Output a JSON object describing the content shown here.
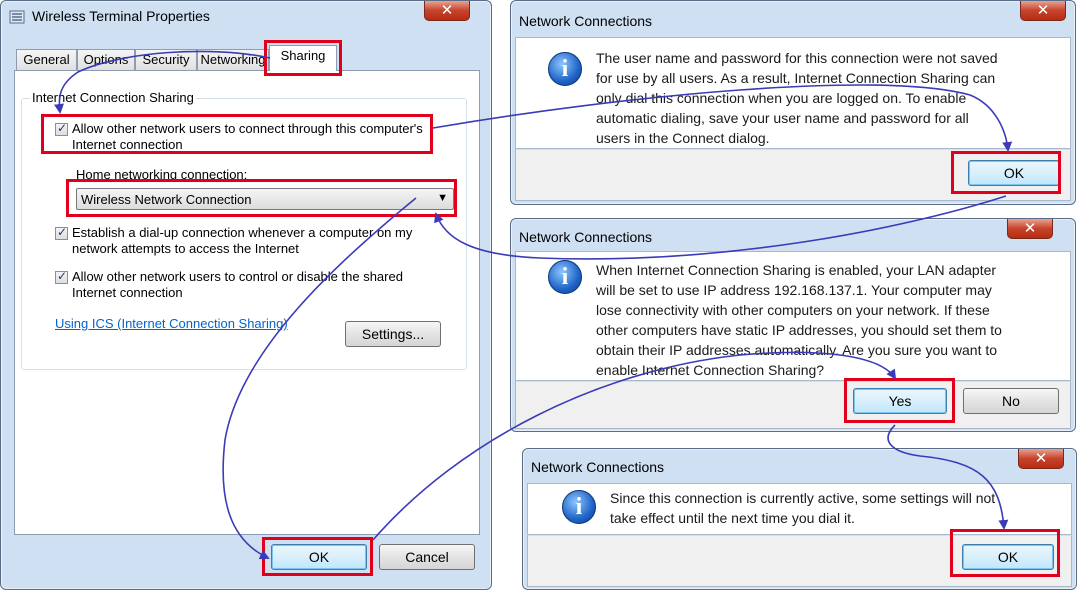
{
  "props_window": {
    "title": "Wireless Terminal Properties",
    "tabs": [
      "General",
      "Options",
      "Security",
      "Networking",
      "Sharing"
    ],
    "active_tab": "Sharing",
    "group_label": "Internet Connection Sharing",
    "allow_connect_label": "Allow other network users to connect through this computer's\nInternet connection",
    "allow_connect_checked": true,
    "home_network_label": "Home networking connection:",
    "home_network_value": "Wireless Network Connection",
    "dialup_label": "Establish a dial-up connection whenever a computer on my\nnetwork attempts to access the Internet",
    "dialup_checked": true,
    "allow_control_label": "Allow other network users to control or disable the shared\nInternet connection",
    "allow_control_checked": true,
    "ics_link": "Using ICS (Internet Connection Sharing)",
    "settings_button": "Settings...",
    "ok_button": "OK",
    "cancel_button": "Cancel"
  },
  "dialog1": {
    "title": "Network Connections",
    "message": "The user name and password for this connection were not saved\nfor use by all users.  As a result,  Internet Connection Sharing can\nonly dial this connection when you are logged on.  To enable\nautomatic dialing, save your user name and password for all\nusers in the Connect dialog.",
    "ok_button": "OK"
  },
  "dialog2": {
    "title": "Network Connections",
    "message": "When Internet Connection Sharing is enabled, your LAN adapter\nwill be set to use IP address 192.168.137.1. Your computer may\nlose connectivity with other computers on your network. If these\nother computers have static IP addresses, you should set them to\nobtain their IP addresses automatically.  Are you sure you want to\nenable Internet Connection Sharing?",
    "yes_button": "Yes",
    "no_button": "No"
  },
  "dialog3": {
    "title": "Network Connections",
    "message": "Since this connection is currently active, some settings will not\ntake effect until the next time you dial it.",
    "ok_button": "OK"
  },
  "colors": {
    "highlight_red": "#e0001b",
    "arrow_blue": "#3b3bb8",
    "close_red": "#c7432b"
  },
  "icons": {
    "window": "network-connection-icon",
    "message": "info-icon",
    "close": "close-icon"
  }
}
